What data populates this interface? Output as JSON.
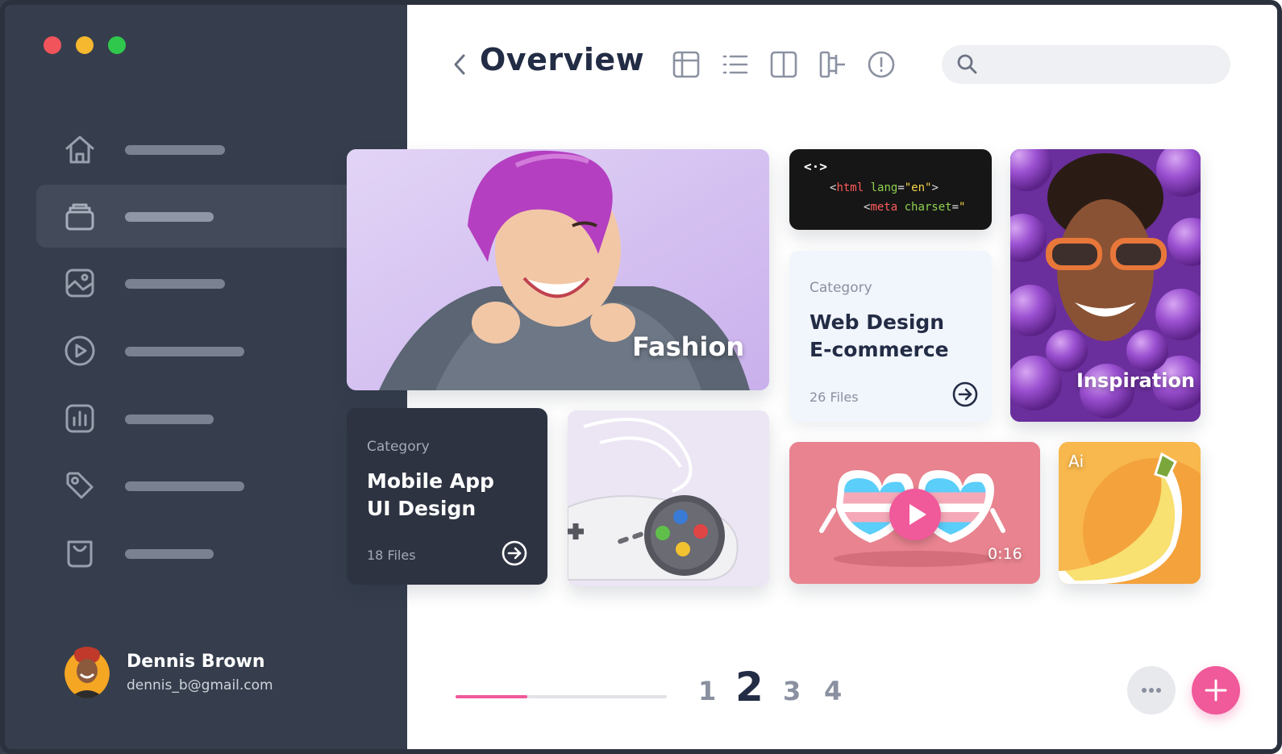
{
  "window": {
    "controls": {
      "close": "#f2545b",
      "minimize": "#f5b82e",
      "maximize": "#2fc84d"
    }
  },
  "sidebar": {
    "items": [
      {
        "icon": "home-icon",
        "active": false
      },
      {
        "icon": "archive-icon",
        "active": true
      },
      {
        "icon": "image-icon",
        "active": false
      },
      {
        "icon": "play-icon",
        "active": false
      },
      {
        "icon": "chart-icon",
        "active": false
      },
      {
        "icon": "tag-icon",
        "active": false
      },
      {
        "icon": "shopping-bag-icon",
        "active": false
      }
    ],
    "user": {
      "name": "Dennis Brown",
      "email": "dennis_b@gmail.com"
    }
  },
  "header": {
    "title": "Overview",
    "tools": [
      "table-icon",
      "list-icon",
      "split-view-icon",
      "hierarchy-icon",
      "info-icon"
    ],
    "search": {
      "placeholder": ""
    }
  },
  "cards": {
    "fashion": {
      "label": "Fashion"
    },
    "code": {
      "line1_tag": "html",
      "line1_attr": "lang",
      "line1_val": "\"en\"",
      "line2_tag": "meta",
      "line2_attr": "charset",
      "line2_val": "\""
    },
    "web_design": {
      "category": "Category",
      "title_line1": "Web Design",
      "title_line2": "E-commerce",
      "files": "26 Files"
    },
    "inspiration": {
      "label": "Inspiration"
    },
    "mobile_app": {
      "category": "Category",
      "title_line1": "Mobile App",
      "title_line2": "UI Design",
      "files": "18 Files"
    },
    "video": {
      "duration": "0:16"
    },
    "ai": {
      "label": "Ai"
    }
  },
  "pagination": {
    "pages": [
      "1",
      "2",
      "3",
      "4"
    ],
    "current": "2",
    "progress": 0.34
  },
  "colors": {
    "accent": "#f0599a",
    "sidebar": "#363e4d",
    "dark_card": "#2d3341",
    "title": "#232c45"
  }
}
